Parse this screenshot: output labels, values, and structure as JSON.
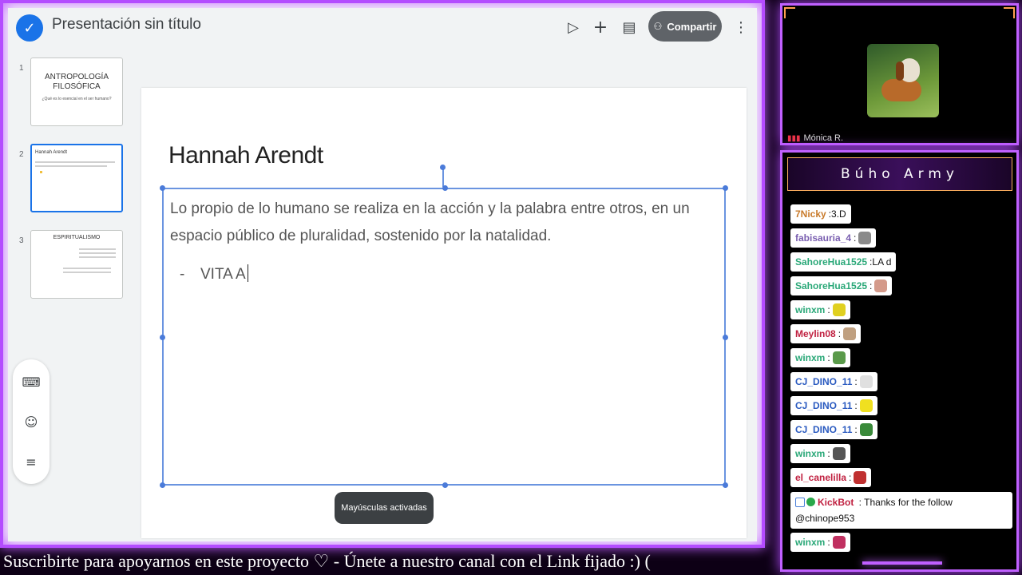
{
  "app": {
    "title": "Presentación sin título",
    "share_label": "Compartir",
    "icons": [
      "check-icon",
      "present-icon",
      "add-icon",
      "comments-icon",
      "person-add-icon",
      "more-icon"
    ]
  },
  "filmstrip": [
    {
      "num": "1",
      "title": "ANTROPOLOGÍA FILOSÓFICA",
      "subtitle": "¿Qué es lo esencial en el ser humano?"
    },
    {
      "num": "2",
      "title": "Hannah Arendt"
    },
    {
      "num": "3",
      "title": "ESPIRITUALISMO"
    }
  ],
  "float_tools": [
    "keyboard-icon",
    "emoji-icon",
    "menu-icon"
  ],
  "slide": {
    "title": "Hannah Arendt",
    "body": "Lo propio de lo humano se realiza en la acción y la palabra entre otros, en un espacio público de pluralidad, sostenido por la natalidad.",
    "bullet_dash": "-",
    "bullet_text": "VITA A"
  },
  "toast": "Mayúsculas activadas",
  "camera": {
    "name": "Mónica R."
  },
  "chat": {
    "header": "Búho Army",
    "messages": [
      {
        "user": "7Nicky",
        "color": "#c87a2a",
        "text": "3.D",
        "emote": ""
      },
      {
        "user": "fabisauria_4",
        "color": "#7a5fb0",
        "text": "",
        "emote": "#8a8a8a"
      },
      {
        "user": "SahoreHua1525",
        "color": "#2aa878",
        "text": "LA d",
        "emote": ""
      },
      {
        "user": "SahoreHua1525",
        "color": "#2aa878",
        "text": "",
        "emote": "#d49a8a"
      },
      {
        "user": "winxm",
        "color": "#2aa878",
        "text": "",
        "emote": "#e0d020"
      },
      {
        "user": "Meylin08",
        "color": "#c02040",
        "text": "",
        "emote": "#c0a080"
      },
      {
        "user": "winxm",
        "color": "#2aa878",
        "text": "",
        "emote": "#5a9a4a"
      },
      {
        "user": "CJ_DINO_11",
        "color": "#2a5ac0",
        "text": "",
        "emote": "#e0e0e0"
      },
      {
        "user": "CJ_DINO_11",
        "color": "#2a5ac0",
        "text": "",
        "emote": "#f0e020"
      },
      {
        "user": "CJ_DINO_11",
        "color": "#2a5ac0",
        "text": "",
        "emote": "#3a8a3a"
      },
      {
        "user": "winxm",
        "color": "#2aa878",
        "text": "",
        "emote": "#555555"
      },
      {
        "user": "el_canelilla",
        "color": "#c02040",
        "text": "",
        "emote": "#c03030"
      }
    ],
    "kick": {
      "user": "KickBot",
      "color": "#c02040",
      "text": "Thanks for the follow",
      "mention": "@chinope953"
    },
    "last": {
      "user": "winxm",
      "color": "#2aa878",
      "emote": "#c03060"
    }
  },
  "ticker": "Suscribirte para apoyarnos en este proyecto ♡ - Únete a nuestro canal con el Link fijado :) ("
}
